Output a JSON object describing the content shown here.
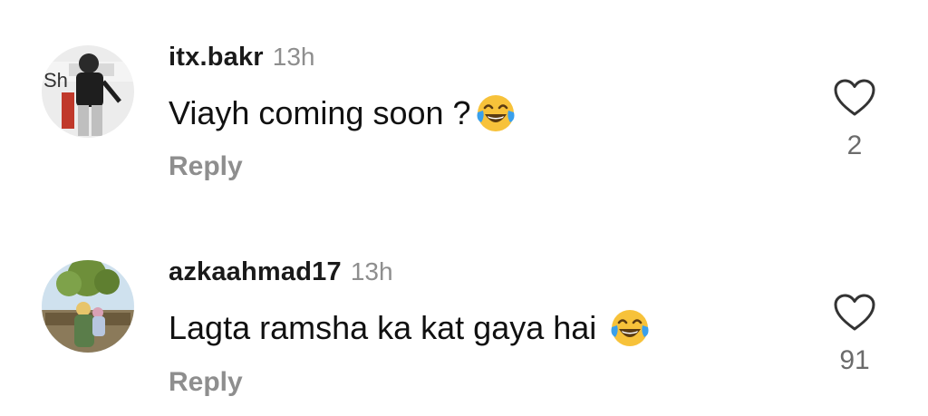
{
  "comments": [
    {
      "username": "itx.bakr",
      "time": "13h",
      "text": "Viayh coming soon ?",
      "emoji": "face-with-tears-of-joy",
      "reply_label": "Reply",
      "like_count": "2",
      "avatar_text": "Sh"
    },
    {
      "username": "azkaahmad17",
      "time": "13h",
      "text": "Lagta ramsha ka kat gaya hai",
      "emoji": "face-with-tears-of-joy",
      "reply_label": "Reply",
      "like_count": "91"
    }
  ],
  "icons": {
    "like": "heart-outline-icon",
    "emoji": "face-with-tears-of-joy"
  },
  "colors": {
    "text": "#111111",
    "muted": "#8e8e8e",
    "count": "#6b6b6b",
    "emoji_yellow": "#f7c23a",
    "tears": "#3aa0ec"
  }
}
